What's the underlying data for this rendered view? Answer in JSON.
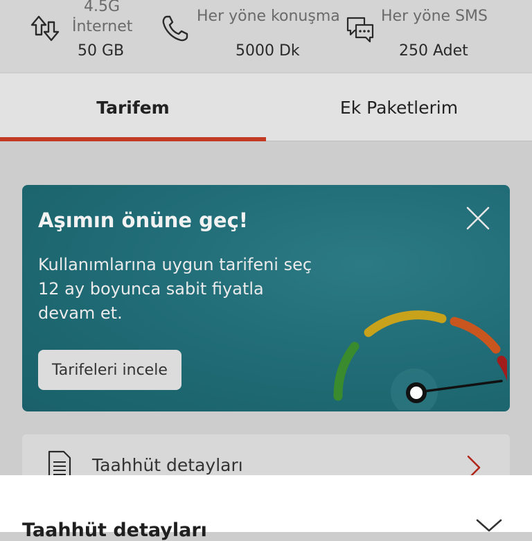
{
  "allowances": {
    "internet": {
      "line1": "4.5G",
      "line2": "İnternet",
      "value": "50 GB"
    },
    "voice": {
      "label": "Her yöne konuşma",
      "value": "5000 Dk"
    },
    "sms": {
      "label": "Her yöne SMS",
      "value": "250 Adet"
    },
    "icons": [
      "data-arrows-icon",
      "phone-icon",
      "chat-bubbles-icon"
    ]
  },
  "tabs": [
    {
      "label": "Tarifem",
      "active": true
    },
    {
      "label": "Ek Paketlerim",
      "active": false
    }
  ],
  "promo": {
    "title": "Aşımın önüne geç!",
    "lines": [
      "Kullanımlarına uygun tarifeni seç",
      "12 ay boyunca sabit fiyatla",
      "devam et."
    ],
    "button": "Tarifeleri incele",
    "icons": [
      "close-icon",
      "speedometer-icon"
    ]
  },
  "list_item": {
    "label": "Taahhüt detayları",
    "icons": [
      "document-icon",
      "chevron-right-icon"
    ]
  },
  "sheet": {
    "title": "Taahhüt detayları",
    "icons": [
      "chevron-down-icon"
    ]
  },
  "colors": {
    "accent": "#c23a23",
    "promo_bg": "#1f6a74",
    "gauge_green": "#3a8a2e",
    "gauge_yellow": "#c9a21c",
    "gauge_orange": "#c8561e",
    "gauge_red": "#a21c1c"
  }
}
